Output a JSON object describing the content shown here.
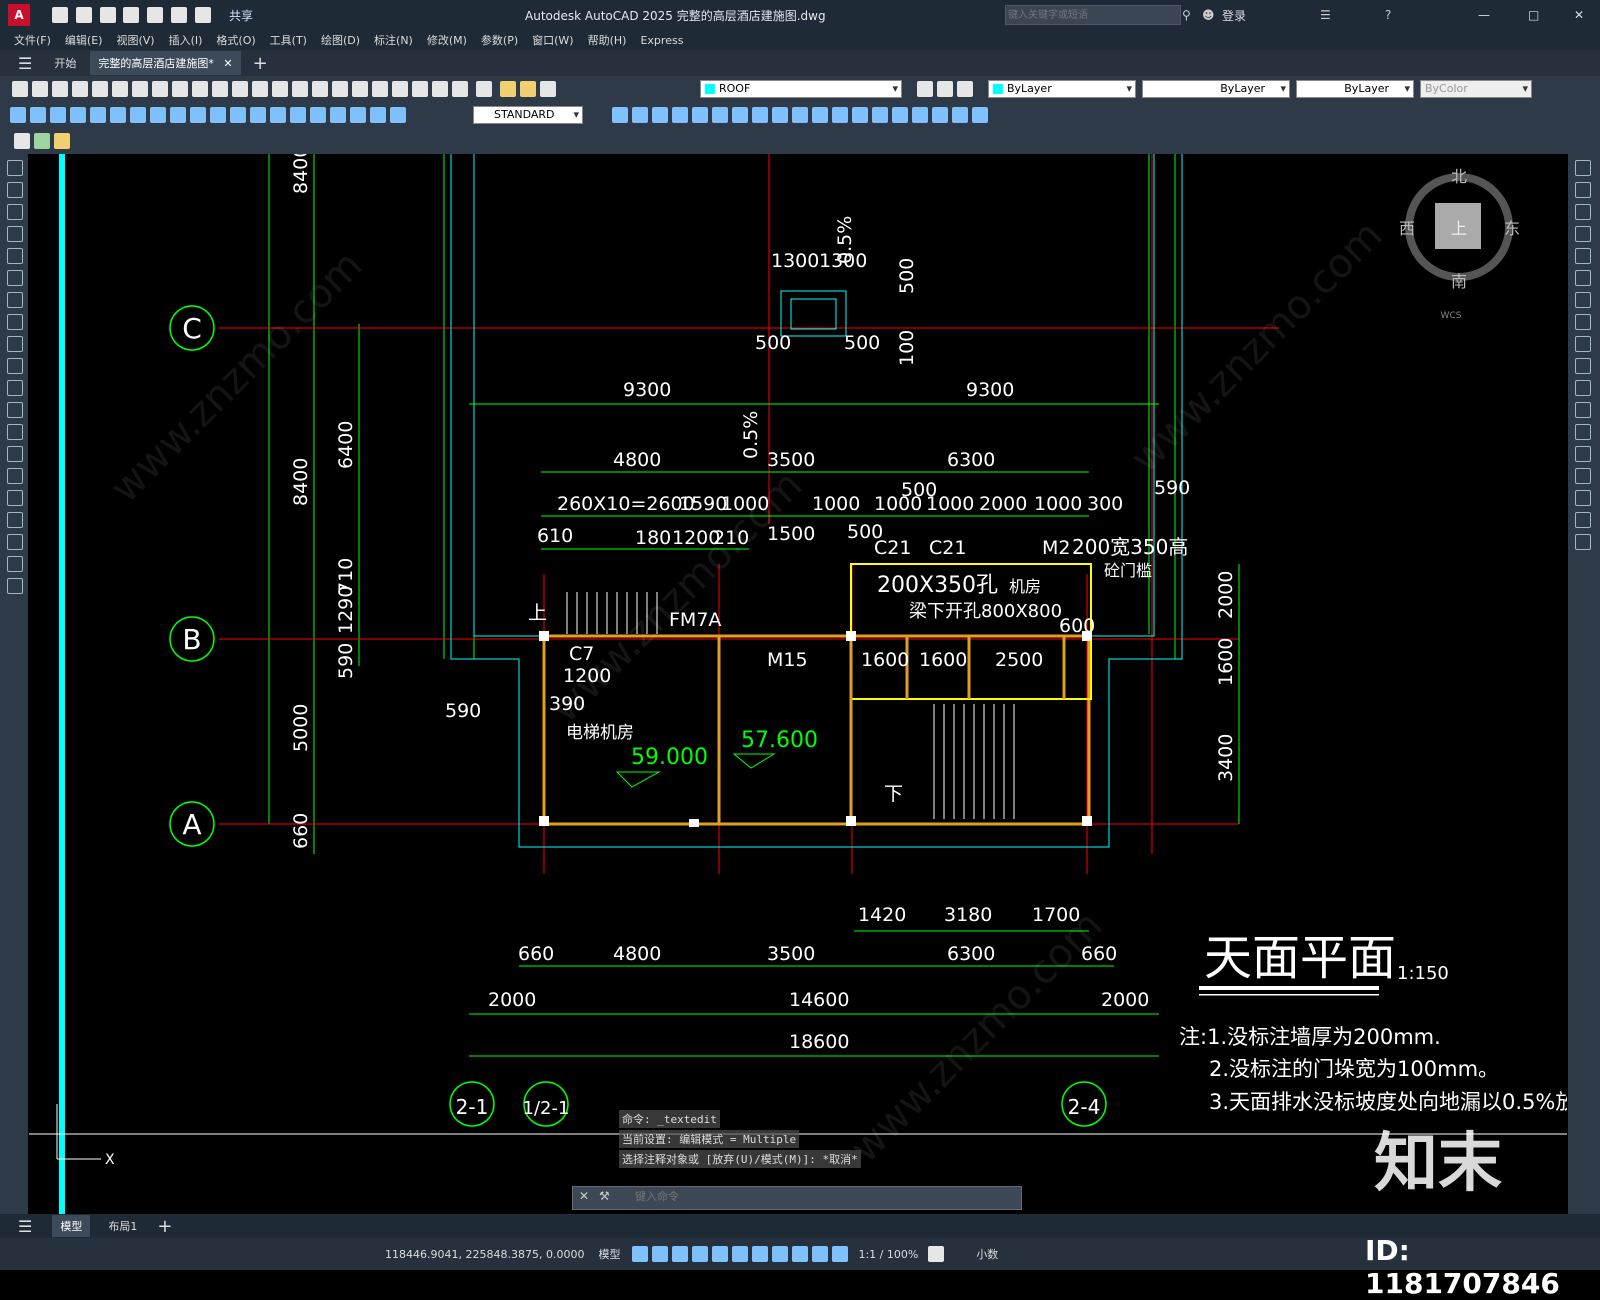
{
  "titlebar": {
    "logo": "A",
    "share": "共享",
    "title": "Autodesk AutoCAD 2025    完整的高层酒店建施图.dwg",
    "search_placeholder": "键入关键字或短语",
    "login": "登录"
  },
  "menus": [
    "文件(F)",
    "编辑(E)",
    "视图(V)",
    "插入(I)",
    "格式(O)",
    "工具(T)",
    "绘图(D)",
    "标注(N)",
    "修改(M)",
    "参数(P)",
    "窗口(W)",
    "帮助(H)",
    "Express"
  ],
  "tabs": {
    "start": "开始",
    "active": "完整的高层酒店建施图*",
    "add": "+"
  },
  "props": {
    "layer": "ROOF",
    "color": "ByLayer",
    "linetype": "ByLayer",
    "lineweight": "ByLayer",
    "plotstyle": "ByColor",
    "textstyle": "STANDARD"
  },
  "viewcube": {
    "north": "北",
    "south": "南",
    "east": "东",
    "west": "西",
    "top": "上",
    "wcs": "WCS"
  },
  "drawing": {
    "grid_labels": [
      "C",
      "B",
      "A",
      "2-1",
      "1/2-1",
      "2-4"
    ],
    "dims_top": [
      "1300",
      "1300",
      "500",
      "500",
      "500",
      "100",
      "0.5%",
      "9300",
      "9300",
      "4800",
      "3500",
      "6300",
      "0.5%",
      "260X10=2600",
      "1590",
      "1000",
      "1000",
      "500",
      "1000",
      "1000",
      "2000",
      "1000",
      "300",
      "590",
      "610",
      "180",
      "1200",
      "210",
      "1500",
      "500"
    ],
    "dims_left": [
      "8400",
      "6400",
      "8400",
      "1290",
      "710",
      "590",
      "5000",
      "660"
    ],
    "dims_right": [
      "2000",
      "1600",
      "3400"
    ],
    "dims_bottom": [
      "1420",
      "3180",
      "1700",
      "660",
      "4800",
      "3500",
      "6300",
      "660",
      "2000",
      "14600",
      "2000",
      "18600"
    ],
    "labels": [
      "C21",
      "C21",
      "M2",
      "200宽350高",
      "砼门槛",
      "200X350孔",
      "机房",
      "梁下开孔800X800",
      "600",
      "FM7A",
      "上",
      "C7",
      "1200",
      "390",
      "590",
      "电梯机房",
      "M15",
      "1600",
      "1600",
      "2500",
      "下"
    ],
    "levels": [
      "59.000",
      "57.600"
    ],
    "plan_title": "天面平面",
    "plan_scale": "1:150",
    "notes": [
      "注:1.没标注墙厚为200mm.",
      "2.没标注的门垛宽为100mm。",
      "3.天面排水没标坡度处向地漏以0.5%放"
    ]
  },
  "command": {
    "lines": [
      "命令: _textedit",
      "当前设置: 编辑模式 = Multiple",
      "选择注释对象或 [放弃(U)/模式(M)]: *取消*"
    ],
    "placeholder": "键入命令"
  },
  "layouts": {
    "model": "模型",
    "layout1": "布局1"
  },
  "status": {
    "coords": "118446.9041, 225848.3875, 0.0000",
    "model": "模型",
    "scale": "1:1 / 100%",
    "units": "小数"
  },
  "watermark": {
    "brand": "知末",
    "id": "ID: 1181707846",
    "site": "www.znzmo.com"
  },
  "colors": {
    "green": "#00ff00",
    "cyan": "#00ffff",
    "red": "#ff0000",
    "yellow": "#ffff00",
    "white": "#ffffff",
    "orange": "#e0a020"
  }
}
